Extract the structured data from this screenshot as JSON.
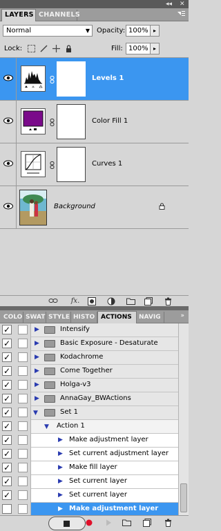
{
  "dock": {
    "collapse": "◂◂",
    "close": "✕"
  },
  "layers_panel": {
    "tabs": [
      {
        "label": "LAYERS",
        "active": true
      },
      {
        "label": "CHANNELS",
        "active": false
      }
    ],
    "menu_icon": "panel-menu-icon",
    "blend_mode": "Normal",
    "opacity_label": "Opacity:",
    "opacity_value": "100%",
    "lock_label": "Lock:",
    "fill_label": "Fill:",
    "fill_value": "100%",
    "layers": [
      {
        "name": "Levels 1",
        "selected": true,
        "thumb": "levels-adjustment-icon"
      },
      {
        "name": "Color Fill 1",
        "selected": false,
        "thumb": "color-fill-icon",
        "fill_color": "#7a0a8a"
      },
      {
        "name": "Curves 1",
        "selected": false,
        "thumb": "curves-adjustment-icon"
      },
      {
        "name": "Background",
        "selected": false,
        "thumb": "photo-thumbnail",
        "locked": true
      }
    ],
    "footer_icons": [
      "link-layers-icon",
      "fx-icon",
      "add-mask-icon",
      "new-adjustment-icon",
      "new-group-icon",
      "new-layer-icon",
      "trash-icon"
    ],
    "fx_label": "fx."
  },
  "actions_panel": {
    "tabs": [
      {
        "label": "COLO",
        "active": false
      },
      {
        "label": "SWAT",
        "active": false
      },
      {
        "label": "STYLE",
        "active": false
      },
      {
        "label": "HISTO",
        "active": false
      },
      {
        "label": "ACTIONS",
        "active": true
      },
      {
        "label": "NAVIG",
        "active": false
      }
    ],
    "more": "»",
    "rows": [
      {
        "kind": "folder",
        "label": "Intensify"
      },
      {
        "kind": "folder",
        "label": "Basic Exposure - Desaturate"
      },
      {
        "kind": "folder",
        "label": "Kodachrome"
      },
      {
        "kind": "folder",
        "label": "Come Together"
      },
      {
        "kind": "folder",
        "label": "Holga-v3"
      },
      {
        "kind": "folder",
        "label": "AnnaGay_BWActions"
      },
      {
        "kind": "set",
        "label": "Set 1"
      },
      {
        "kind": "action",
        "label": "Action 1"
      },
      {
        "kind": "step",
        "label": "Make adjustment layer"
      },
      {
        "kind": "step",
        "label": "Set current adjustment layer"
      },
      {
        "kind": "step",
        "label": "Make fill layer"
      },
      {
        "kind": "step",
        "label": "Set current layer"
      },
      {
        "kind": "step",
        "label": "Set current layer"
      },
      {
        "kind": "step",
        "label": "Make adjustment layer",
        "selected": true
      }
    ],
    "footer_icons": [
      "stop-icon",
      "record-icon",
      "play-icon",
      "new-set-icon",
      "new-action-icon",
      "trash-icon"
    ]
  },
  "colors": {
    "selection": "#3b96f0",
    "record": "#e0102a",
    "color_fill": "#7a0a8a"
  }
}
